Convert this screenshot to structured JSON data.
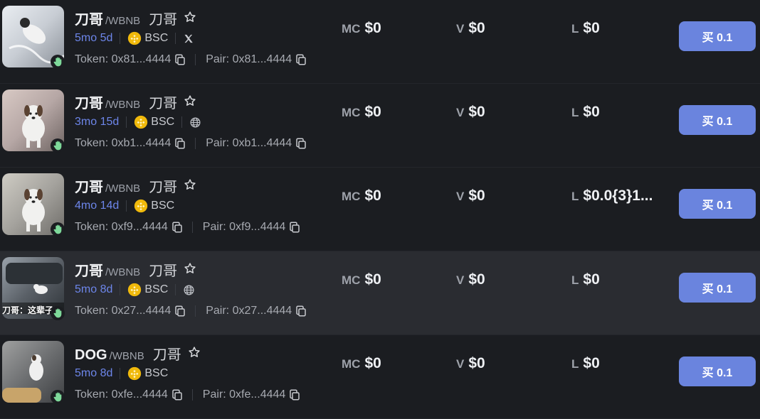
{
  "rows": [
    {
      "symbol": "刀哥",
      "quote": "/WBNB",
      "name": "刀哥",
      "age": "5mo 5d",
      "chain": "BSC",
      "social": "x",
      "token": "Token: 0x81...4444",
      "pair": "Pair: 0x81...4444",
      "mc_label": "MC",
      "mc": "$0",
      "v_label": "V",
      "v": "$0",
      "l_label": "L",
      "l": "$0",
      "buy": "买 0.1",
      "highlight": false
    },
    {
      "symbol": "刀哥",
      "quote": "/WBNB",
      "name": "刀哥",
      "age": "3mo 15d",
      "chain": "BSC",
      "social": "globe",
      "token": "Token: 0xb1...4444",
      "pair": "Pair: 0xb1...4444",
      "mc_label": "MC",
      "mc": "$0",
      "v_label": "V",
      "v": "$0",
      "l_label": "L",
      "l": "$0",
      "buy": "买 0.1",
      "highlight": false
    },
    {
      "symbol": "刀哥",
      "quote": "/WBNB",
      "name": "刀哥",
      "age": "4mo 14d",
      "chain": "BSC",
      "social": "",
      "token": "Token: 0xf9...4444",
      "pair": "Pair: 0xf9...4444",
      "mc_label": "MC",
      "mc": "$0",
      "v_label": "V",
      "v": "$0",
      "l_label": "L",
      "l": "$0.0{3}1...",
      "buy": "买 0.1",
      "highlight": false
    },
    {
      "symbol": "刀哥",
      "quote": "/WBNB",
      "name": "刀哥",
      "age": "5mo 8d",
      "chain": "BSC",
      "social": "globe",
      "token": "Token: 0x27...4444",
      "pair": "Pair: 0x27...4444",
      "mc_label": "MC",
      "mc": "$0",
      "v_label": "V",
      "v": "$0",
      "l_label": "L",
      "l": "$0",
      "buy": "买 0.1",
      "highlight": true,
      "thumb_caption": "刀哥：这辈子"
    },
    {
      "symbol": "DOG",
      "quote": "/WBNB",
      "name": "刀哥",
      "age": "5mo 8d",
      "chain": "BSC",
      "social": "",
      "token": "Token: 0xfe...4444",
      "pair": "Pair: 0xfe...4444",
      "mc_label": "MC",
      "mc": "$0",
      "v_label": "V",
      "v": "$0",
      "l_label": "L",
      "l": "$0",
      "buy": "买 0.1",
      "highlight": false
    }
  ],
  "colors": {
    "background": "#1b1d21",
    "highlight_row": "#2a2c31",
    "age_accent": "#6d86ea",
    "buy_button": "#6a84de",
    "bsc_yellow": "#f0b90b",
    "badge_green": "#7ed99a"
  },
  "icons": {
    "chain": "bnb-chain-icon",
    "copy": "copy-icon",
    "star": "star-icon",
    "badge": "hand-icon",
    "x": "x-social-icon",
    "globe": "globe-icon"
  }
}
